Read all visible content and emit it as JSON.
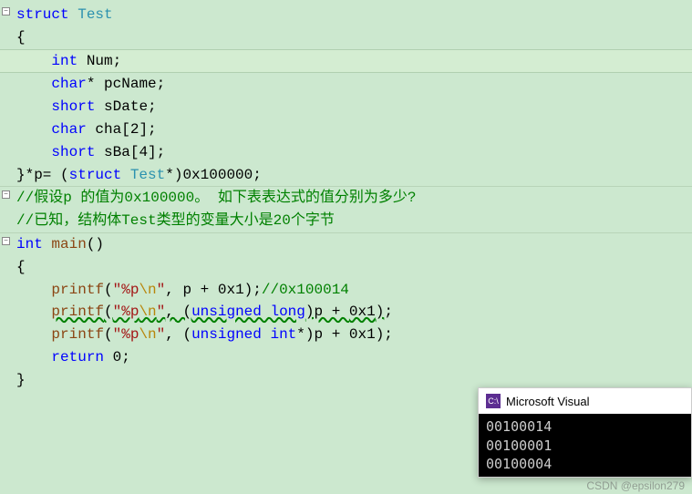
{
  "code": {
    "struct_kw": "struct",
    "struct_name": "Test",
    "open_brace": "{",
    "field1_type": "int",
    "field1_name": "Num",
    "field2_type": "char",
    "field2_ptr": "*",
    "field2_name": "pcName",
    "field3_type": "short",
    "field3_name": "sDate",
    "field4_type": "char",
    "field4_name": "cha",
    "field4_dim": "[2]",
    "field5_type": "short",
    "field5_name": "sBa",
    "field5_dim": "[4]",
    "close_struct": "}*p= (",
    "close_struct_kw": "struct",
    "close_struct_type": " Test",
    "close_struct_tail": "*)0x100000;",
    "hex1": "0x100000",
    "comment1": "//假设p 的值为0x100000。 如下表表达式的值分别为多少?",
    "comment2": "//已知，结构体Test类型的变量大小是20个字节",
    "int_kw": "int",
    "main_name": "main",
    "main_paren": "()",
    "printf_name": "printf",
    "fmt1": "\"%p",
    "fmt_esc": "\\n",
    "fmt_close": "\"",
    "p1_arg": ", p + 0x1);",
    "p1_comment": "//0x100014",
    "p2_arg": ", (",
    "p2_ul": "unsigned long",
    "p2_tail": ")p + 0x1);",
    "p3_ui": "unsigned int",
    "p3_tail": "*)p + 0x1);",
    "return_kw": "return",
    "return_val": " 0;",
    "hex_small": "0x1"
  },
  "console": {
    "title": "Microsoft Visual",
    "icon_text": "C:\\",
    "out1": "00100014",
    "out2": "00100001",
    "out3": "00100004"
  },
  "watermark": "CSDN @epsilon279",
  "chart_data": {
    "type": "table",
    "title": "printf pointer arithmetic outputs",
    "rows": [
      {
        "expression": "p + 0x1",
        "output": "00100014"
      },
      {
        "expression": "(unsigned long)p + 0x1",
        "output": "00100001"
      },
      {
        "expression": "(unsigned int*)p + 0x1",
        "output": "00100004"
      }
    ],
    "assumptions": {
      "p": "0x100000",
      "sizeof_struct_Test": 20
    }
  }
}
